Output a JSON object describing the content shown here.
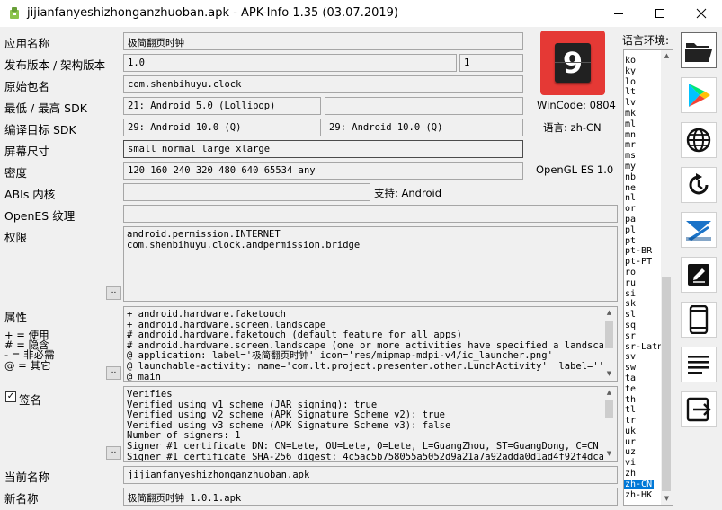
{
  "window": {
    "title": "jijianfanyeshizhonganzhuoban.apk - APK-Info 1.35 (03.07.2019)"
  },
  "labels": {
    "app_name": "应用名称",
    "version": "发布版本 / 架构版本",
    "package": "原始包名",
    "sdk": "最低 / 最高 SDK",
    "target_sdk": "编译目标 SDK",
    "screen": "屏幕尺寸",
    "density": "密度",
    "abis": "ABIs 内核",
    "opengl_tex": "OpenES 纹理",
    "permissions": "权限",
    "features": "属性",
    "legend_use": "+ = 使用",
    "legend_implied": "# = 隐含",
    "legend_notrequired": "- = 非必需",
    "legend_other": "@ = 其它",
    "signature": "签名",
    "current_name": "当前名称",
    "new_name": "新名称",
    "wincode": "WinCode: 0804",
    "language": "语言: zh-CN",
    "opengl": "OpenGL ES 1.0",
    "support": "支持: Android",
    "locales": "语言环境:"
  },
  "fields": {
    "app_name": "极简翻页时钟",
    "version": "1.0",
    "version_code": "1",
    "package": "com.shenbihuyu.clock",
    "min_sdk": "21: Android 5.0 (Lollipop)",
    "max_sdk": "",
    "target_sdk_a": "29: Android 10.0 (Q)",
    "target_sdk_b": "29: Android 10.0 (Q)",
    "screen": "small normal large xlarge",
    "density": "120 160 240 320 480 640 65534 any",
    "abis": "",
    "opengl_tex": "",
    "permissions": "android.permission.INTERNET\ncom.shenbihuyu.clock.andpermission.bridge",
    "features": "+ android.hardware.faketouch\n+ android.hardware.screen.landscape\n# android.hardware.faketouch (default feature for all apps)\n# android.hardware.screen.landscape (one or more activities have specified a landscape o\n@ application: label='极简翻页时钟' icon='res/mipmap-mdpi-v4/ic_launcher.png'\n@ launchable-activity: name='com.lt.project.presenter.other.LunchActivity'  label='' ico\n@ main",
    "signature": "Verifies\nVerified using v1 scheme (JAR signing): true\nVerified using v2 scheme (APK Signature Scheme v2): true\nVerified using v3 scheme (APK Signature Scheme v3): false\nNumber of signers: 1\nSigner #1 certificate DN: CN=Lete, OU=Lete, O=Lete, L=GuangZhou, ST=GuangDong, C=CN\nSigner #1 certificate SHA-256 digest: 4c5ac5b758055a5052d9a21a7a92adda0d1ad4f92f4dca9af2",
    "current_name": "jijianfanyeshizhonganzhuoban.apk",
    "new_name": "极简翻页时钟 1.0.1.apk"
  },
  "app_icon": {
    "digit": "9",
    "bg": "#e53935"
  },
  "signature_checked": true,
  "locales": [
    "ko",
    "ky",
    "lo",
    "lt",
    "lv",
    "mk",
    "ml",
    "mn",
    "mr",
    "ms",
    "my",
    "nb",
    "ne",
    "nl",
    "or",
    "pa",
    "pl",
    "pt",
    "pt-BR",
    "pt-PT",
    "ro",
    "ru",
    "si",
    "sk",
    "sl",
    "sq",
    "sr",
    "sr-Latn",
    "sv",
    "sw",
    "ta",
    "te",
    "th",
    "tl",
    "tr",
    "uk",
    "ur",
    "uz",
    "vi",
    "zh",
    "zh-CN",
    "zh-HK"
  ],
  "selected_locale": "zh-CN",
  "dots_label": "..",
  "side_buttons": [
    "folder-icon",
    "play-store-icon",
    "globe-icon",
    "refresh-icon",
    "apkmirror-icon",
    "edit-icon",
    "phone-icon",
    "list-icon",
    "exit-icon"
  ]
}
